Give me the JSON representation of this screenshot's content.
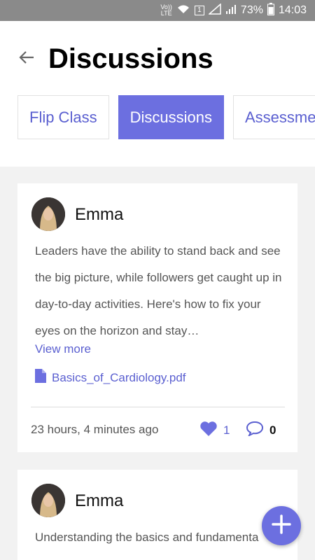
{
  "status_bar": {
    "network_label_top": "Vo))",
    "network_label_bottom": "LTE",
    "sim_slot": "1",
    "battery_percent": "73%",
    "time": "14:03"
  },
  "header": {
    "title": "Discussions",
    "tabs": [
      {
        "label": "Flip Class",
        "active": false
      },
      {
        "label": "Discussions",
        "active": true
      },
      {
        "label": "Assessme",
        "active": false
      }
    ]
  },
  "posts": [
    {
      "author": "Emma",
      "text": "Leaders have the ability to stand back and see the big picture, while followers get caught up in day-to-day activities. Here's how to fix your eyes on the horizon and stay…",
      "view_more": "View more",
      "attachment": "Basics_of_Cardiology.pdf",
      "time_ago": "23 hours, 4 minutes ago",
      "likes": "1",
      "comments": "0"
    },
    {
      "author": "Emma",
      "text": "Understanding the basics and fundamenta"
    }
  ],
  "colors": {
    "accent": "#6c6fe0",
    "accent_text": "#5a5fd0",
    "status_bar": "#8a8a8a"
  },
  "icons": {
    "back": "arrow-left-icon",
    "attachment": "file-icon",
    "like": "heart-icon",
    "comment": "speech-bubble-icon",
    "fab": "plus-icon"
  }
}
